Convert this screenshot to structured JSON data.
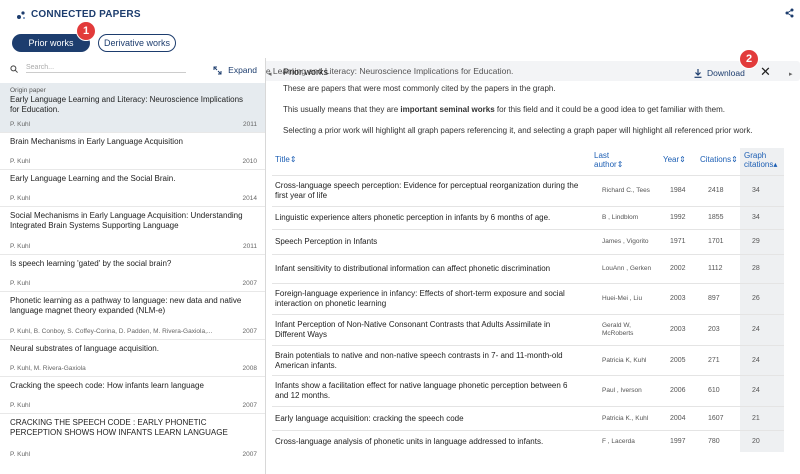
{
  "app": {
    "title": "CONNECTED PAPERS"
  },
  "tabs": {
    "prior": "Prior works",
    "derivative": "Derivative works"
  },
  "badges": {
    "one": "1",
    "two": "2"
  },
  "search": {
    "value": "Early Language Learning and Literacy: Neuroscience Implications for Education."
  },
  "sidebar": {
    "search_placeholder": "Search...",
    "expand_label": "Expand",
    "origin_label": "Origin paper",
    "papers": [
      {
        "title": "Early Language Learning and Literacy: Neuroscience Implications for Education.",
        "authors": "P. Kuhl",
        "year": "2011"
      },
      {
        "title": "Brain Mechanisms in Early Language Acquisition",
        "authors": "P. Kuhl",
        "year": "2010"
      },
      {
        "title": "Early Language Learning and the Social Brain.",
        "authors": "P. Kuhl",
        "year": "2014"
      },
      {
        "title": "Social Mechanisms in Early Language Acquisition: Understanding Integrated Brain Systems Supporting Language",
        "authors": "P. Kuhl",
        "year": "2011"
      },
      {
        "title": "Is speech learning 'gated' by the social brain?",
        "authors": "P. Kuhl",
        "year": "2007"
      },
      {
        "title": "Phonetic learning as a pathway to language: new data and native language magnet theory expanded (NLM-e)",
        "authors": "P. Kuhl, B. Conboy, S. Coffey-Corina, D. Padden, M. Rivera-Gaxiola,...",
        "year": "2007"
      },
      {
        "title": "Neural substrates of language acquisition.",
        "authors": "P. Kuhl, M. Rivera-Gaxiola",
        "year": "2008"
      },
      {
        "title": "Cracking the speech code: How infants learn language",
        "authors": "P. Kuhl",
        "year": "2007"
      },
      {
        "title": "CRACKING THE SPEECH CODE : EARLY PHONETIC PERCEPTION SHOWS HOW INFANTS LEARN LANGUAGE",
        "authors": "P. Kuhl",
        "year": "2007"
      }
    ]
  },
  "panel": {
    "title": "Prior works",
    "download": "Download",
    "close": "✕",
    "desc1": "These are papers that were most commonly cited by the papers in the graph.",
    "desc2_pre": "This usually means that they are ",
    "desc2_bold": "important seminal works",
    "desc2_post": " for this field and it could be a good idea to get familiar with them.",
    "desc3": "Selecting a prior work will highlight all graph papers referencing it, and selecting a graph paper will highlight all referenced prior work."
  },
  "table": {
    "headers": {
      "title": "Title",
      "author_1": "Last",
      "author_2": "author",
      "year": "Year",
      "citations": "Citations",
      "graph_1": "Graph",
      "graph_2": "citations"
    },
    "rows": [
      {
        "title": "Cross-language speech perception: Evidence for perceptual reorganization during the first year of life",
        "author": "Richard C., Tees",
        "year": "1984",
        "citations": "2418",
        "graph": "34"
      },
      {
        "title": "Linguistic experience alters phonetic perception in infants by 6 months of age.",
        "author": "B , Lindblom",
        "year": "1992",
        "citations": "1855",
        "graph": "34"
      },
      {
        "title": "Speech Perception in Infants",
        "author": "James , Vigorito",
        "year": "1971",
        "citations": "1701",
        "graph": "29"
      },
      {
        "title": "Infant sensitivity to distributional information can affect phonetic discrimination",
        "author": "LouAnn , Gerken",
        "year": "2002",
        "citations": "1112",
        "graph": "28"
      },
      {
        "title": "Foreign-language experience in infancy: Effects of short-term exposure and social interaction on phonetic learning",
        "author": "Huei-Mei , Liu",
        "year": "2003",
        "citations": "897",
        "graph": "26"
      },
      {
        "title": "Infant Perception of Non-Native Consonant Contrasts that Adults Assimilate in Different Ways",
        "author": "Gerald W, McRoberts",
        "year": "2003",
        "citations": "203",
        "graph": "24"
      },
      {
        "title": "Brain potentials to native and non-native speech contrasts in 7- and 11-month-old American infants.",
        "author": "Patricia K, Kuhl",
        "year": "2005",
        "citations": "271",
        "graph": "24"
      },
      {
        "title": "Infants show a facilitation effect for native language phonetic perception between 6 and 12 months.",
        "author": "Paul , Iverson",
        "year": "2006",
        "citations": "610",
        "graph": "24"
      },
      {
        "title": "Early language acquisition: cracking the speech code",
        "author": "Patricia K., Kuhl",
        "year": "2004",
        "citations": "1607",
        "graph": "21"
      },
      {
        "title": "Cross-language analysis of phonetic units in language addressed to infants.",
        "author": "F , Lacerda",
        "year": "1997",
        "citations": "780",
        "graph": "20"
      }
    ]
  }
}
